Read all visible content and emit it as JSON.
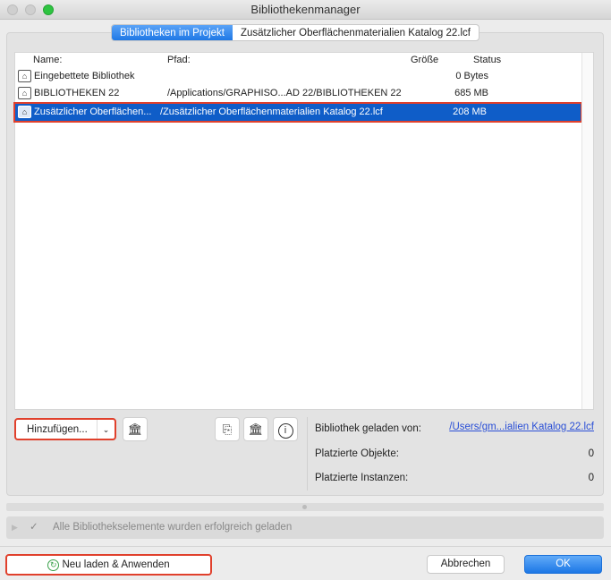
{
  "window": {
    "title": "Bibliothekenmanager"
  },
  "tabs": [
    {
      "label": "Bibliotheken im Projekt",
      "active": true
    },
    {
      "label": "Zusätzlicher Oberflächenmaterialien Katalog 22.lcf",
      "active": false
    }
  ],
  "table": {
    "headers": {
      "name": "Name:",
      "path": "Pfad:",
      "size": "Größe",
      "status": "Status"
    },
    "rows": [
      {
        "name": "Eingebettete Bibliothek",
        "path": "",
        "size": "0 Bytes",
        "icon": "embedded-library-icon"
      },
      {
        "name": "BIBLIOTHEKEN 22",
        "path": "/Applications/GRAPHISO...AD 22/BIBLIOTHEKEN 22",
        "size": "685 MB",
        "icon": "library-folder-icon"
      },
      {
        "name": "Zusätzlicher Oberflächen...",
        "path": "/Zusätzlicher Oberflächenmaterialien Katalog 22.lcf",
        "size": "208 MB",
        "icon": "library-folder-icon",
        "selected": true
      }
    ]
  },
  "controls": {
    "add_label": "Hinzufügen..."
  },
  "info": {
    "loaded_from_label": "Bibliothek geladen von:",
    "loaded_from_value": "/Users/gm...ialien Katalog 22.lcf",
    "placed_objects_label": "Platzierte Objekte:",
    "placed_objects_value": "0",
    "placed_instances_label": "Platzierte Instanzen:",
    "placed_instances_value": "0"
  },
  "status": {
    "message": "Alle Bibliothekselemente wurden erfolgreich geladen"
  },
  "footer": {
    "reload_label": "Neu laden & Anwenden",
    "cancel_label": "Abbrechen",
    "ok_label": "OK"
  }
}
